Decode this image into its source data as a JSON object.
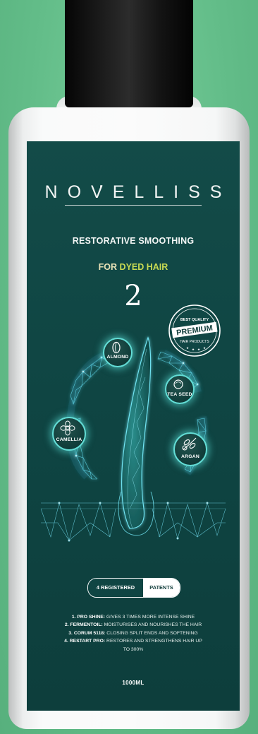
{
  "product": {
    "brand": "NOVELLISS",
    "title": "RESTORATIVE SMOOTHING",
    "target_prefix": "FOR",
    "target_accent": "DYED HAIR",
    "step_number": "2",
    "volume": "1000ML"
  },
  "seal": {
    "top": "BEST QUALITY",
    "main": "PREMIUM",
    "bottom": "HAIR PRODUCTS"
  },
  "ingredients": [
    {
      "label": "ALMOND",
      "icon": "almond-icon"
    },
    {
      "label": "TEA SEED",
      "icon": "tea-seed-icon"
    },
    {
      "label": "CAMELLIA",
      "icon": "camellia-flower-icon"
    },
    {
      "label": "ARGAN",
      "icon": "argan-branch-icon"
    }
  ],
  "patents": {
    "left": "4 REGISTERED",
    "right": "PATENTS"
  },
  "claims": [
    {
      "name": "1. PRO SHINE:",
      "text": " GIVES 3 TIMES MORE INTENSE SHINE"
    },
    {
      "name": "2. FERMENTOIL:",
      "text": " MOISTURISES AND NOURISHES THE HAIR"
    },
    {
      "name": "3. CORUM 5118:",
      "text": " CLOSING SPLIT ENDS AND SOFTENING"
    },
    {
      "name": "4. RESTART PRO:",
      "text": " RESTORES AND STRENGTHENS HAIR UP"
    },
    {
      "name": "",
      "text": "TO 300%"
    }
  ],
  "colors": {
    "background": "#63bd89",
    "label": "#0f4543",
    "glow": "#63ddd6",
    "accent_text": "#c9db52",
    "cap": "#111111"
  }
}
